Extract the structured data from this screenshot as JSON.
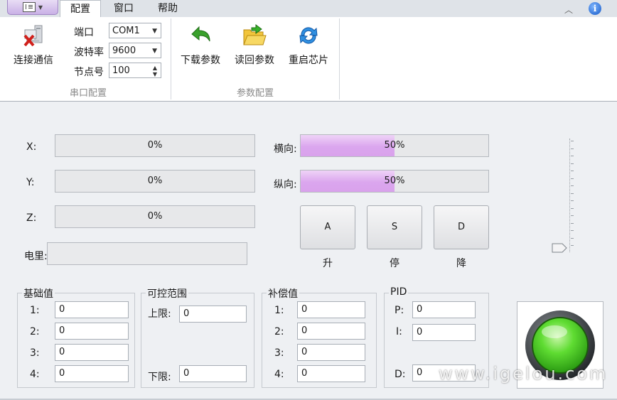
{
  "tabs": {
    "config": "配置",
    "window": "窗口",
    "help": "帮助"
  },
  "ribbon": {
    "connect_label": "连接通信",
    "port_label": "端口",
    "port_value": "COM1",
    "baud_label": "波特率",
    "baud_value": "9600",
    "node_label": "节点号",
    "node_value": "100",
    "group_serial": "串口配置",
    "download_label": "下载参数",
    "readback_label": "读回参数",
    "restart_label": "重启芯片",
    "group_params": "参数配置"
  },
  "axes": {
    "x_label": "X:",
    "x_value": "0%",
    "y_label": "Y:",
    "y_value": "0%",
    "z_label": "Z:",
    "z_value": "0%",
    "power_label": "电里:"
  },
  "direction": {
    "horizontal_label": "横向:",
    "horizontal_text": "50%",
    "horizontal_fill": 0.5,
    "vertical_label": "纵向:",
    "vertical_text": "50%",
    "vertical_fill": 0.5
  },
  "buttons": {
    "a": "A",
    "s": "S",
    "d": "D",
    "up": "升",
    "stop": "停",
    "down": "降"
  },
  "base": {
    "title": "基础值",
    "r1": "1:",
    "r2": "2:",
    "r3": "3:",
    "r4": "4:",
    "v1": "0",
    "v2": "0",
    "v3": "0",
    "v4": "0"
  },
  "range": {
    "title": "可控范围",
    "upper_label": "上限:",
    "upper_value": "0",
    "lower_label": "下限:",
    "lower_value": "0"
  },
  "comp": {
    "title": "补偿值",
    "r1": "1:",
    "r2": "2:",
    "r3": "3:",
    "r4": "4:",
    "v1": "0",
    "v2": "0",
    "v3": "0",
    "v4": "0"
  },
  "pid": {
    "title": "PID",
    "p_label": "P:",
    "p_value": "0",
    "i_label": "I:",
    "i_value": "0",
    "d_label": "D:",
    "d_value": "0"
  },
  "slider": {
    "level": 0
  },
  "status_light": {
    "color": "#37c11d"
  },
  "watermark": "www.igelou.com",
  "colors": {
    "progress": "#dba6ee",
    "accent": "#1559c6"
  }
}
